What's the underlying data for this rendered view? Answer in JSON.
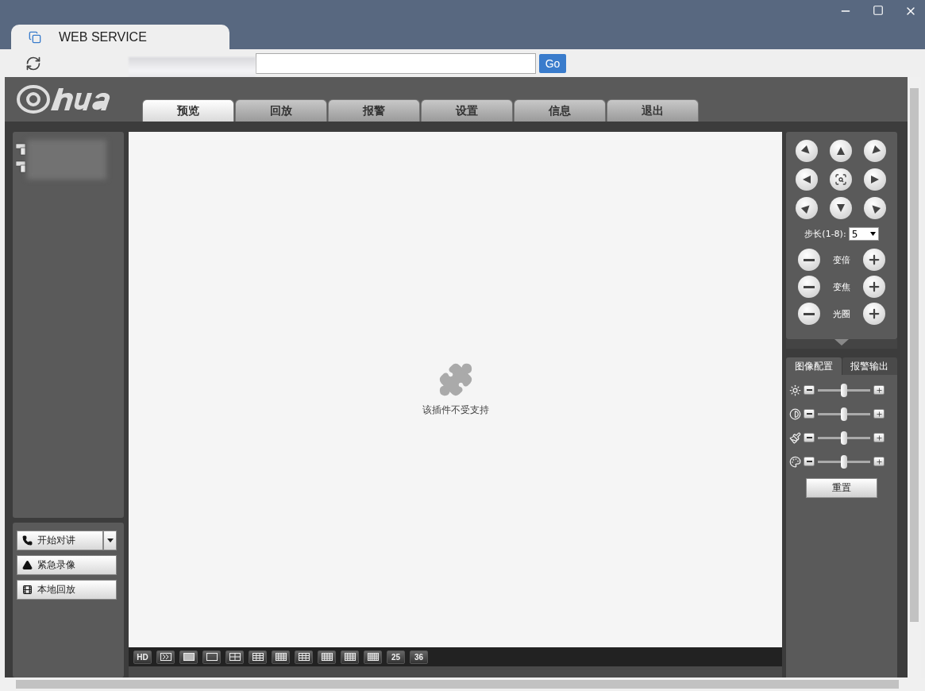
{
  "browser": {
    "tab_title": "WEB SERVICE",
    "go_button": "Go"
  },
  "nav_tabs": [
    {
      "label": "预览",
      "selected": true
    },
    {
      "label": "回放",
      "selected": false
    },
    {
      "label": "报警",
      "selected": false
    },
    {
      "label": "设置",
      "selected": false
    },
    {
      "label": "信息",
      "selected": false
    },
    {
      "label": "退出",
      "selected": false
    }
  ],
  "device_tree": {
    "items": [
      {
        "kind": "camera"
      },
      {
        "kind": "camera"
      }
    ]
  },
  "actions": [
    {
      "kind": "talk",
      "label": "开始对讲"
    },
    {
      "kind": "alarm",
      "label": "紧急录像"
    },
    {
      "kind": "film",
      "label": "本地回放"
    }
  ],
  "video": {
    "message": "该插件不受支持"
  },
  "layout_buttons": [
    {
      "kind": "text",
      "label": "HD"
    },
    {
      "kind": "stream"
    },
    {
      "kind": "full"
    },
    {
      "kind": "grid1"
    },
    {
      "kind": "grid4"
    },
    {
      "kind": "grid6"
    },
    {
      "kind": "grid8"
    },
    {
      "kind": "grid9"
    },
    {
      "kind": "grid13"
    },
    {
      "kind": "grid16"
    },
    {
      "kind": "grid20"
    },
    {
      "kind": "text",
      "label": "25"
    },
    {
      "kind": "text",
      "label": "36"
    }
  ],
  "ptz": {
    "step_label": "步长(1-8):",
    "step_value": "5",
    "adjust_rows": [
      {
        "label": "变倍"
      },
      {
        "label": "变焦"
      },
      {
        "label": "光圈"
      }
    ]
  },
  "image_tabs": [
    {
      "label": "图像配置",
      "selected": true
    },
    {
      "label": "报警输出",
      "selected": false
    }
  ],
  "image_sliders": [
    {
      "kind": "brightness",
      "level": 0.5
    },
    {
      "kind": "contrast",
      "level": 0.5
    },
    {
      "kind": "saturation",
      "level": 0.5
    },
    {
      "kind": "hue",
      "level": 0.5
    }
  ],
  "reset_button": "重置"
}
